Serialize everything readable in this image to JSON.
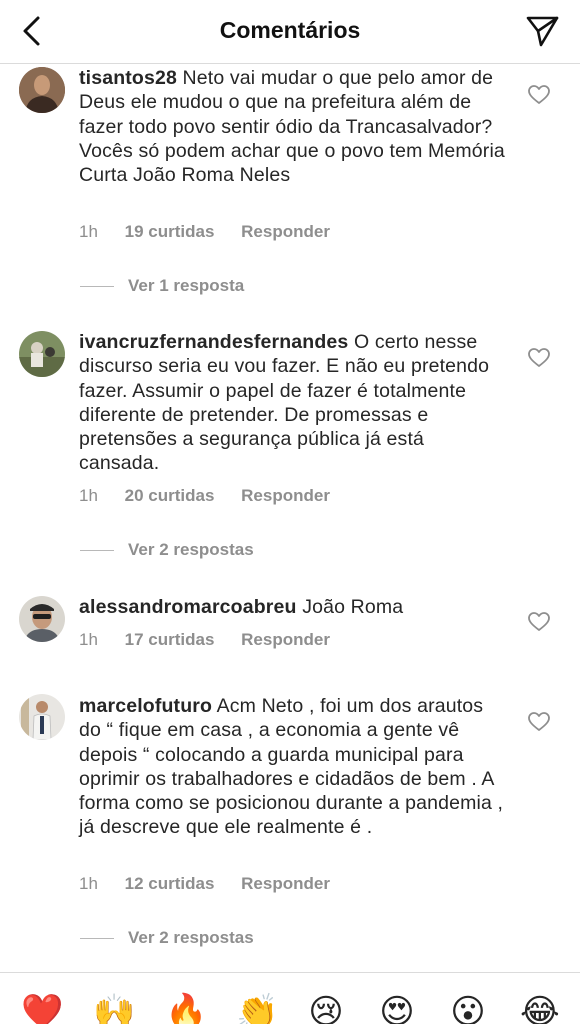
{
  "header": {
    "title": "Comentários"
  },
  "comments": [
    {
      "username": "tisantos28",
      "text": "Neto vai mudar o que pelo amor de Deus ele mudou o que na prefeitura além de fazer todo povo sentir ódio da Trancasalvador? Vocês só podem achar que o povo tem Memória Curta João Roma Neles",
      "time": "1h",
      "likes": "19 curtidas",
      "reply_label": "Responder",
      "view_replies": "Ver 1 resposta"
    },
    {
      "username": "ivancruzfernandesfernandes",
      "text": "O certo nesse discurso seria eu vou fazer. E não eu pretendo fazer. Assumir o papel de fazer é totalmente diferente de pretender. De promessas e pretensões a segurança pública já está cansada.",
      "time": "1h",
      "likes": "20 curtidas",
      "reply_label": "Responder",
      "view_replies": "Ver 2 respostas"
    },
    {
      "username": "alessandromarcoabreu",
      "text": "João Roma",
      "time": "1h",
      "likes": "17 curtidas",
      "reply_label": "Responder",
      "view_replies": ""
    },
    {
      "username": "marcelofuturo",
      "text": "Acm Neto , foi um dos arautos do “ fique em casa , a economia a gente vê depois “ colocando a guarda municipal para oprimir os trabalhadores e cidadãos de bem . A forma como se posicionou durante a pandemia , já descreve que ele realmente é .",
      "time": "1h",
      "likes": "12 curtidas",
      "reply_label": "Responder",
      "view_replies": "Ver 2 respostas"
    }
  ],
  "emoji_bar": [
    "❤️",
    "🙌",
    "🔥",
    "👏",
    "😢",
    "😍",
    "😮",
    "😂"
  ],
  "icons": {
    "back": "chevron-left-icon",
    "send": "paper-plane-icon",
    "like": "heart-outline-icon"
  },
  "colors": {
    "text": "#262626",
    "secondary": "#8e8e8e",
    "divider": "#dbdbdb"
  }
}
